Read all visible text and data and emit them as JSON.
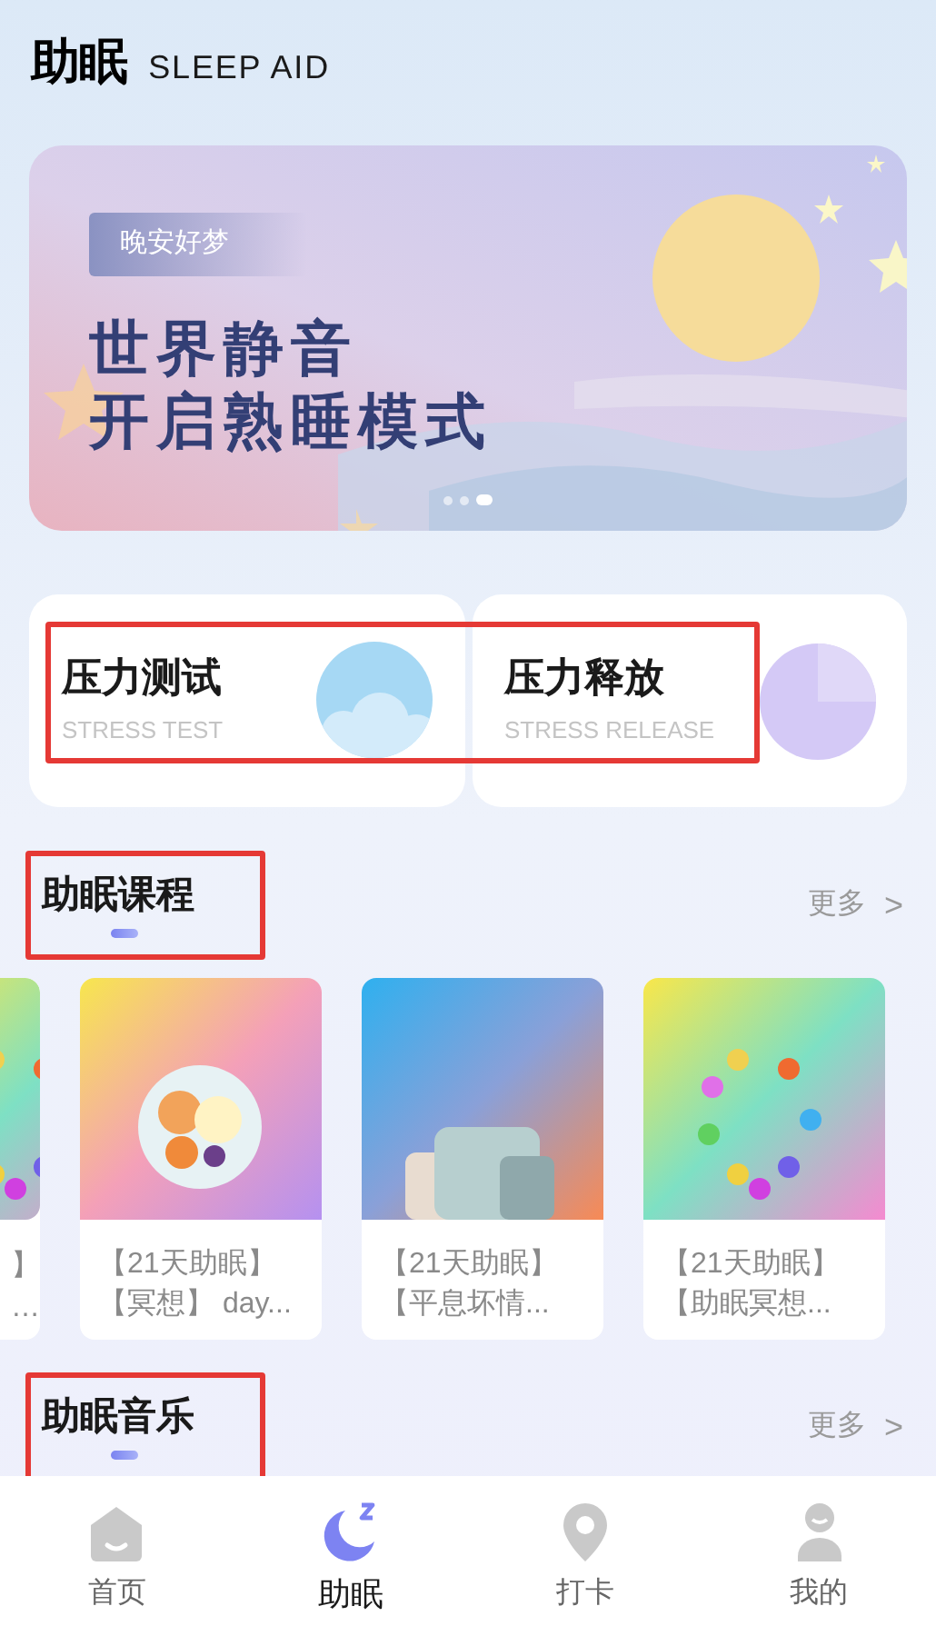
{
  "header": {
    "title": "助眠",
    "subtitle": "SLEEP AID"
  },
  "banner": {
    "tag": "晚安好梦",
    "headline": [
      "世界静音",
      "开启熟睡模式"
    ],
    "dots": [
      {
        "selected": false
      },
      {
        "selected": false
      },
      {
        "selected": true
      }
    ]
  },
  "feature_cards": {
    "highlighted": true,
    "items": [
      {
        "kind": "cloud",
        "title": "压力测试",
        "subtitle": "STRESS TEST"
      },
      {
        "kind": "disc",
        "title": "压力释放",
        "subtitle": "STRESS RELEASE"
      }
    ]
  },
  "courses_section": {
    "title": "助眠课程",
    "highlighted": true,
    "more": "更多",
    "more_arrow": ">",
    "courses": [
      {
        "kind": "partial",
        "title": [
          "】",
          "…"
        ]
      },
      {
        "kind": "full",
        "title": [
          "【21天助眠】",
          "【冥想】 day..."
        ]
      },
      {
        "kind": "full",
        "title": [
          "【21天助眠】",
          "【平息坏情..."
        ]
      },
      {
        "kind": "full",
        "title": [
          "【21天助眠】",
          "【助眠冥想..."
        ]
      }
    ]
  },
  "music_section": {
    "title": "助眠音乐",
    "highlighted": true,
    "more": "更多",
    "more_arrow": ">"
  },
  "tab_bar": [
    {
      "kind": "home",
      "label": "首页",
      "selected": false
    },
    {
      "kind": "sleep",
      "label": "助眠",
      "selected": true
    },
    {
      "kind": "checkin",
      "label": "打卡",
      "selected": false
    },
    {
      "kind": "me",
      "label": "我的",
      "selected": false
    }
  ]
}
